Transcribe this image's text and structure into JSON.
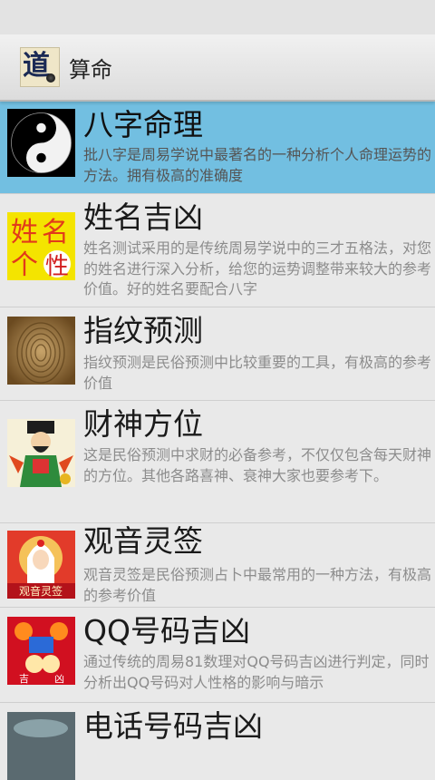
{
  "actionbar": {
    "app_icon": "dao-logo-icon",
    "title": "算命"
  },
  "list": [
    {
      "title": "八字命理",
      "desc": "批八字是周易学说中最著名的一种分析个人命理运势的方法。拥有极高的准确度",
      "icon": "yin-yang-icon"
    },
    {
      "title": "姓名吉凶",
      "desc": "姓名测试采用的是传统周易学说中的三才五格法，对您的姓名进行深入分析，给您的运势调整带来较大的参考价值。好的姓名要配合八字",
      "icon": "name-test-icon"
    },
    {
      "title": "指纹预测",
      "desc": "指纹预测是民俗预测中比较重要的工具，有极高的参考价值",
      "icon": "fingerprint-icon"
    },
    {
      "title": "财神方位",
      "desc": "这是民俗预测中求财的必备参考，不仅仅包含每天财神的方位。其他各路喜神、衰神大家也要参考下。",
      "icon": "god-of-wealth-icon"
    },
    {
      "title": "观音灵签",
      "desc": "观音灵签是民俗预测占卜中最常用的一种方法，有极高的参考价值",
      "icon": "guanyin-icon"
    },
    {
      "title": "QQ号码吉凶",
      "desc": "通过传统的周易81数理对QQ号码吉凶进行判定，同时分析出QQ号码对人性格的影响与暗示",
      "icon": "qq-number-icon"
    },
    {
      "title": "电话号码吉凶",
      "desc": "",
      "icon": "phone-number-icon"
    }
  ],
  "thumb_text": {
    "name_top_left": "姓",
    "name_top_right": "名",
    "name_bottom_left": "个",
    "name_bottom_right": "性",
    "guanyin_label": "观音灵签",
    "qq_label1": "吉",
    "qq_label2": "凶"
  }
}
